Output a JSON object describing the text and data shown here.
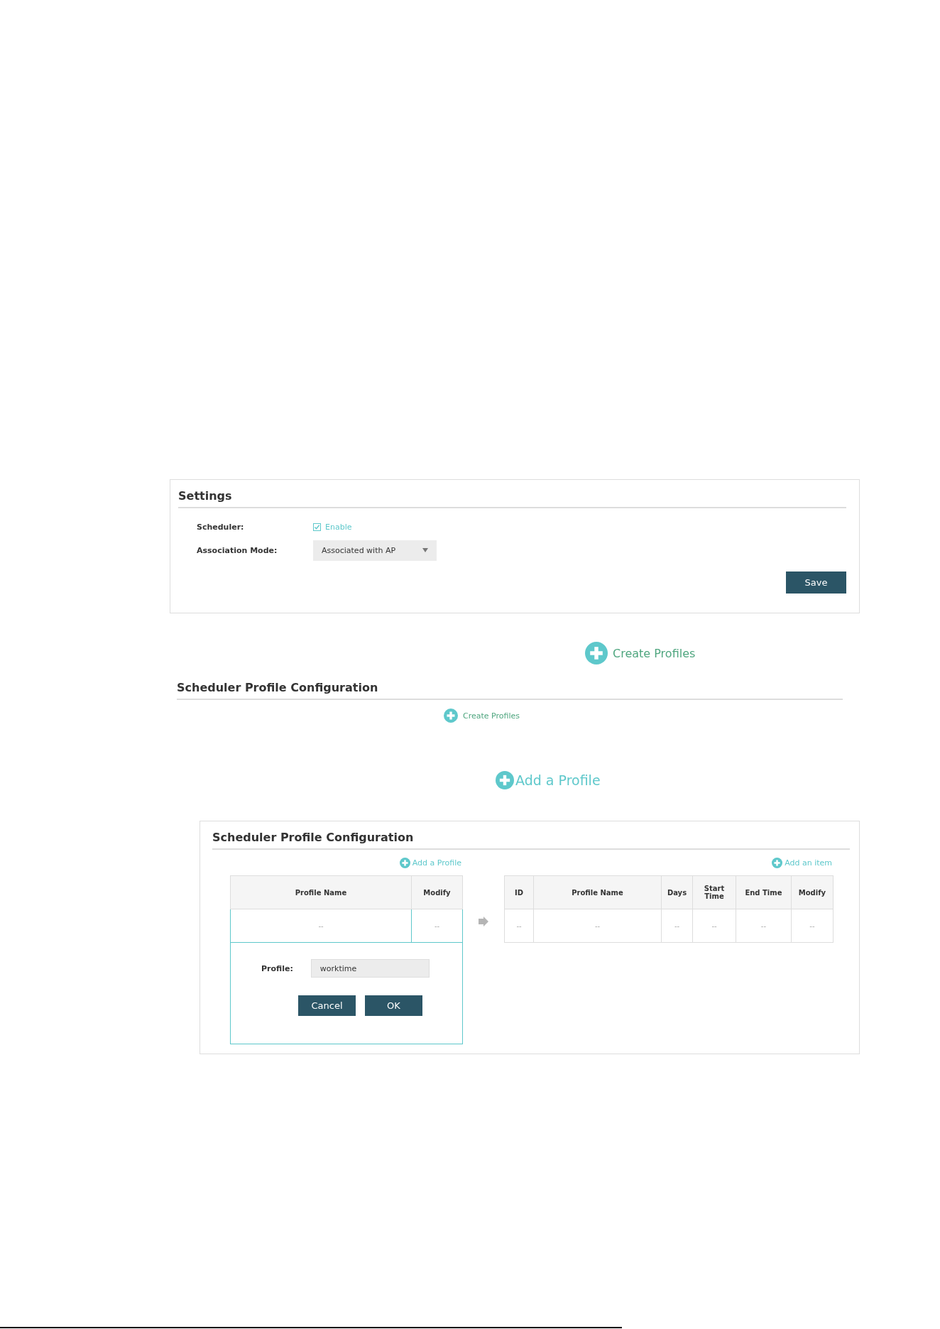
{
  "settings": {
    "title": "Settings",
    "fields": [
      {
        "kind": "checkbox",
        "label": "Scheduler:",
        "option": "Enable",
        "checked": true
      },
      {
        "kind": "dropdown",
        "label": "Association Mode:",
        "value": "Associated with AP"
      }
    ],
    "save_button": "Save"
  },
  "create_profiles_large": "Create Profiles",
  "profile_section": {
    "title": "Scheduler Profile Configuration",
    "create_button": "Create Profiles"
  },
  "add_profile_large": "Add a Profile",
  "profile_panel": {
    "title": "Scheduler Profile Configuration",
    "profiles_table": {
      "add_button": "Add a Profile",
      "columns": [
        "Profile Name",
        "Modify"
      ],
      "rows": [
        [
          "--",
          "--"
        ]
      ],
      "editor": {
        "label": "Profile:",
        "value": "worktime",
        "buttons": [
          "Cancel",
          "OK"
        ]
      }
    },
    "items_table": {
      "add_button": "Add an item",
      "columns": [
        "ID",
        "Profile Name",
        "Days",
        "Start Time",
        "End Time",
        "Modify"
      ],
      "rows": [
        [
          "--",
          "--",
          "--",
          "--",
          "--",
          "--"
        ]
      ]
    }
  }
}
